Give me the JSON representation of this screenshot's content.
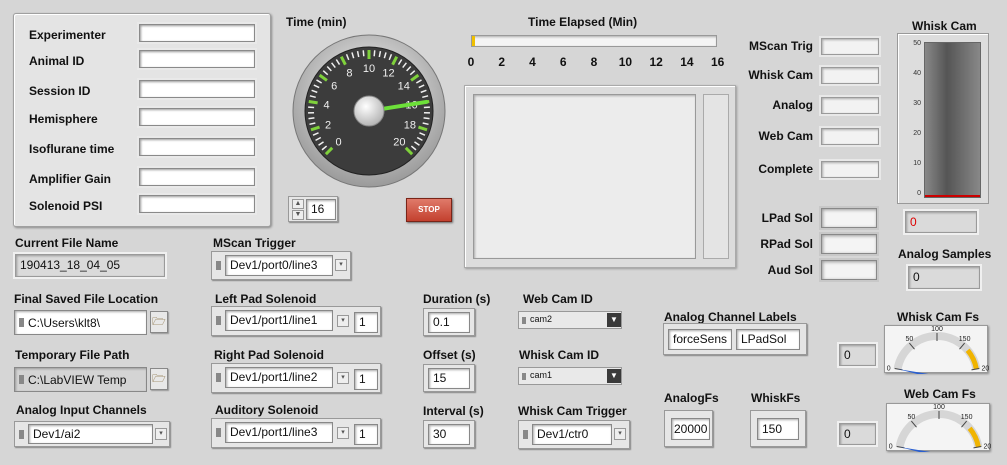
{
  "session": {
    "fields": [
      {
        "label": "Experimenter",
        "value": ""
      },
      {
        "label": "Animal ID",
        "value": ""
      },
      {
        "label": "Session ID",
        "value": ""
      },
      {
        "label": "Hemisphere",
        "value": ""
      },
      {
        "label": "Isoflurane time",
        "value": ""
      },
      {
        "label": "Amplifier Gain",
        "value": ""
      },
      {
        "label": "Solenoid PSI",
        "value": ""
      }
    ]
  },
  "time_gauge": {
    "title": "Time (min)",
    "ticks": [
      "0",
      "2",
      "4",
      "6",
      "8",
      "10",
      "12",
      "14",
      "16",
      "18",
      "20"
    ],
    "control_value": "16",
    "stop_label": "STOP"
  },
  "elapsed": {
    "title": "Time Elapsed (Min)",
    "ticks": [
      "0",
      "2",
      "4",
      "6",
      "8",
      "10",
      "12",
      "14",
      "16"
    ],
    "progress_fraction": 0.0
  },
  "status_leds": {
    "items": [
      "MScan Trig",
      "Whisk Cam",
      "Analog",
      "Web Cam",
      "Complete"
    ]
  },
  "solenoid_leds": {
    "items": [
      "LPad Sol",
      "RPad Sol",
      "Aud Sol"
    ]
  },
  "whisk_cam_meter": {
    "title": "Whisk Cam",
    "ticks": [
      "50",
      "40",
      "30",
      "20",
      "10",
      "0"
    ],
    "value": "0",
    "fill_fraction": 0.0
  },
  "analog_samples": {
    "label": "Analog Samples",
    "value": "0"
  },
  "files": {
    "current_label": "Current File Name",
    "current_value": "190413_18_04_05",
    "final_label": "Final Saved File Location",
    "final_value": "C:\\Users\\klt8\\",
    "temp_label": "Temporary File Path",
    "temp_value": "C:\\LabVIEW Temp",
    "analog_label": "Analog Input Channels",
    "analog_value": "Dev1/ai2"
  },
  "lines": {
    "mscan_label": "MScan Trigger",
    "mscan_value": "Dev1/port0/line3",
    "left_label": "Left Pad Solenoid",
    "left_value": "Dev1/port1/line1",
    "left_num": "1",
    "right_label": "Right Pad Solenoid",
    "right_value": "Dev1/port1/line2",
    "right_num": "1",
    "aud_label": "Auditory Solenoid",
    "aud_value": "Dev1/port1/line3",
    "aud_num": "1"
  },
  "timing": {
    "duration_label": "Duration (s)",
    "duration_value": "0.1",
    "offset_label": "Offset (s)",
    "offset_value": "15",
    "interval_label": "Interval (s)",
    "interval_value": "30"
  },
  "cams": {
    "web_label": "Web Cam ID",
    "web_value": "cam2",
    "whisk_label": "Whisk Cam ID",
    "whisk_value": "cam1",
    "trigger_label": "Whisk Cam Trigger",
    "trigger_value": "Dev1/ctr0"
  },
  "analog_channels": {
    "label": "Analog Channel Labels",
    "items": [
      "forceSens",
      "LPadSol"
    ]
  },
  "rates": {
    "analogfs_label": "AnalogFs",
    "analogfs_value": "20000",
    "whiskfs_label": "WhiskFs",
    "whiskfs_value": "150"
  },
  "fs_gauges": {
    "whisk": {
      "title": "Whisk Cam Fs",
      "value": "0",
      "ticks": [
        "0",
        "50",
        "100",
        "150",
        "20"
      ]
    },
    "web": {
      "title": "Web Cam Fs",
      "value": "0",
      "ticks": [
        "0",
        "50",
        "100",
        "150",
        "20"
      ]
    }
  }
}
